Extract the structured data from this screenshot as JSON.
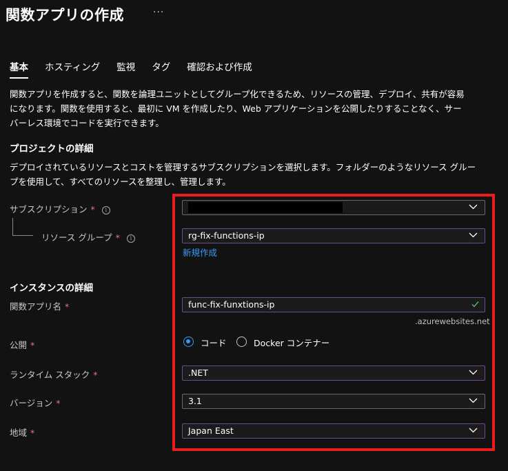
{
  "header": {
    "title": "関数アプリの作成",
    "more": "···"
  },
  "tabs": [
    {
      "label": "基本"
    },
    {
      "label": "ホスティング"
    },
    {
      "label": "監視"
    },
    {
      "label": "タグ"
    },
    {
      "label": "確認および作成"
    }
  ],
  "intro": {
    "line1": "関数アプリを作成すると、関数を論理ユニットとしてグループ化できるため、リソースの管理、デプロイ、共有が容易",
    "line2": "になります。関数を使用すると、最初に VM を作成したり、Web アプリケーションを公開したりすることなく、サー",
    "line3": "バーレス環境でコードを実行できます。"
  },
  "project": {
    "heading": "プロジェクトの詳細",
    "desc1": "デプロイされているリソースとコストを管理するサブスクリプションを選択します。フォルダーのようなリソース グルー",
    "desc2": "プを使用して、すべてのリソースを整理し、管理します。",
    "subscription": {
      "label": "サブスクリプション",
      "required": "*",
      "value": ""
    },
    "resource_group": {
      "label": "リソース グループ",
      "required": "*",
      "value": "rg-fix-functions-ip",
      "create_new": "新規作成"
    }
  },
  "instance": {
    "heading": "インスタンスの詳細",
    "app_name": {
      "label": "関数アプリ名",
      "required": "*",
      "value": "func-fix-funxtions-ip",
      "suffix": ".azurewebsites.net"
    },
    "publish": {
      "label": "公開",
      "required": "*",
      "options": [
        "コード",
        "Docker コンテナー"
      ],
      "selected": "コード"
    },
    "runtime": {
      "label": "ランタイム スタック",
      "required": "*",
      "value": ".NET"
    },
    "version": {
      "label": "バージョン",
      "required": "*",
      "value": "3.1"
    },
    "region": {
      "label": "地域",
      "required": "*",
      "value": "Japan East"
    }
  },
  "colors": {
    "accent": "#3899f7",
    "highlight": "#ee1b1b",
    "required": "#f1707b",
    "valid": "#5cb85c",
    "field_border": "#6e4a8f"
  }
}
